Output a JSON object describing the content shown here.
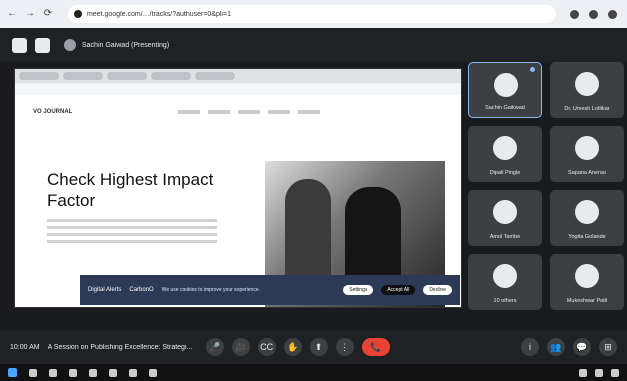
{
  "browser": {
    "url": "meet.google.com/…/tracks/?authuser=0&pli=1"
  },
  "meeting": {
    "presenting_label": "Sachin Gaiwad (Presenting)",
    "time": "10:00 AM",
    "title": "A Session on Publishing Excellence: Strategi..."
  },
  "shared_page": {
    "logo": "VO JOURNAL",
    "hero_title_line1": "Check Highest Impact",
    "hero_title_line2": "Factor",
    "cookie": {
      "brand": "Digital Alerts",
      "carbon": "CarbonO",
      "message": "We use cookies to improve your experience.",
      "btn_settings": "Settings",
      "btn_accept": "Accept All",
      "btn_decline": "Decline"
    }
  },
  "participants": [
    {
      "name": "Sachin Gaikwad",
      "active": true
    },
    {
      "name": "Dr. Umesh Lotlikar",
      "active": false
    },
    {
      "name": "Dipali Pingle",
      "active": false
    },
    {
      "name": "Sapana Anerao",
      "active": false
    },
    {
      "name": "Amol Tambe",
      "active": false
    },
    {
      "name": "Yogita Golande",
      "active": false
    },
    {
      "name": "10 others",
      "active": false
    },
    {
      "name": "Mukeshwar Patil",
      "active": false
    }
  ]
}
